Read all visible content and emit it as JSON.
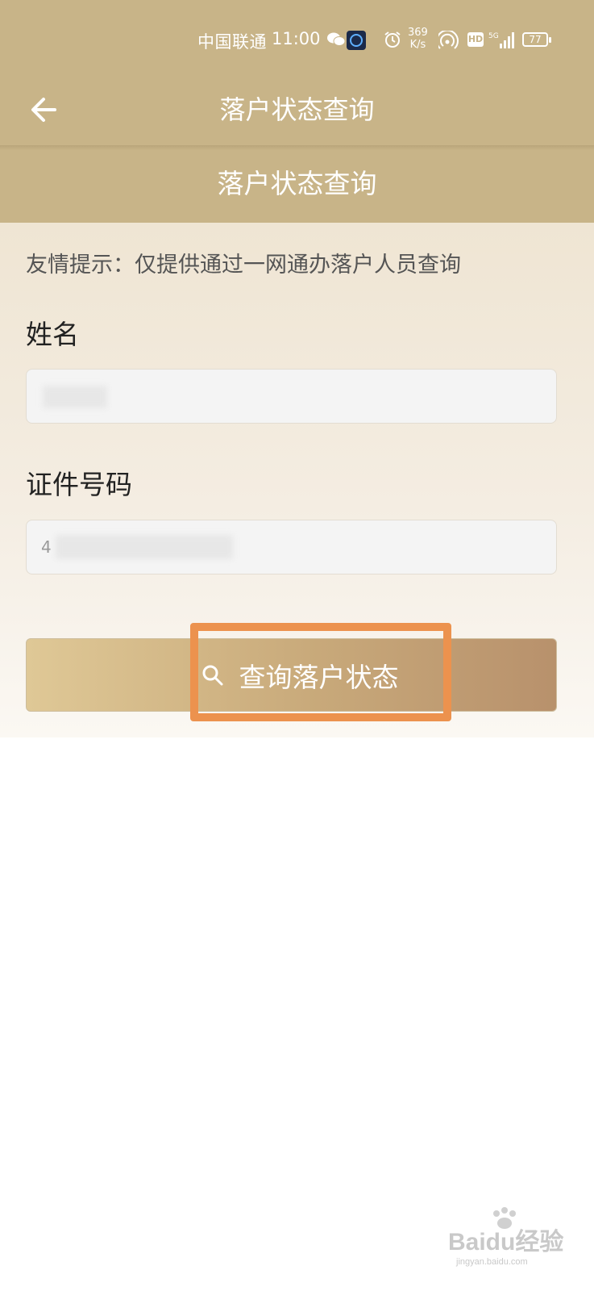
{
  "status_bar": {
    "carrier": "中国联通",
    "time": "11:00",
    "speed_value": "369",
    "speed_unit": "K/s",
    "network": "5G",
    "battery": "77",
    "icons": [
      "wechat-icon",
      "app-icon",
      "alarm-icon",
      "hotspot-icon",
      "hd-icon",
      "signal-icon",
      "battery-icon"
    ]
  },
  "header": {
    "title": "落户状态查询",
    "back_icon": "arrow-left-icon"
  },
  "section": {
    "title": "落户状态查询"
  },
  "form": {
    "tip": "友情提示：仅提供通过一网通办落户人员查询",
    "name_label": "姓名",
    "name_value": "",
    "id_label": "证件号码",
    "id_value": "4",
    "submit_label": "查询落户状态",
    "submit_icon": "search-icon"
  },
  "colors": {
    "header_bg": "#c8b488",
    "button_start": "#dfc896",
    "button_end": "#b8916c",
    "highlight": "#ec924e"
  },
  "watermark": {
    "logo": "Baidu经验",
    "url": "jingyan.baidu.com"
  }
}
